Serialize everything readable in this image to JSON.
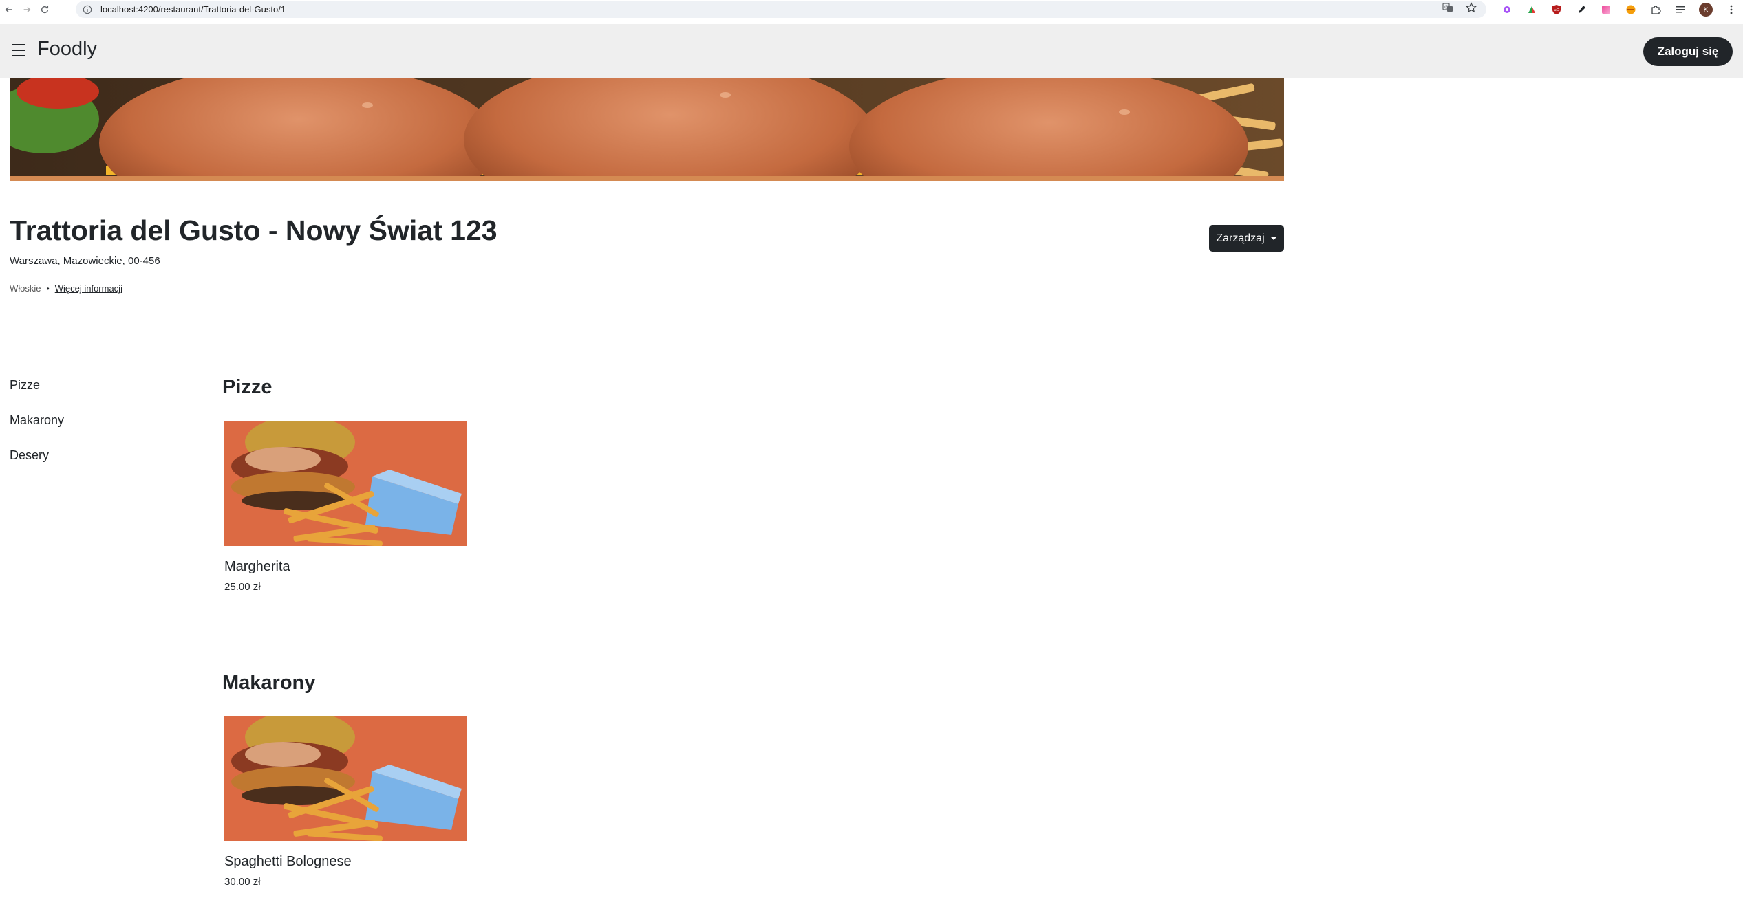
{
  "browser": {
    "url": "localhost:4200/restaurant/Trattoria-del-Gusto/1",
    "profile_initial": "K",
    "icons": [
      "back-arrow-icon",
      "forward-arrow-icon",
      "reload-icon",
      "site-info-icon",
      "translate-icon",
      "bookmark-star-icon",
      "extension-icons",
      "puzzle-extensions-icon",
      "reading-list-icon",
      "kebab-menu-icon"
    ]
  },
  "navbar": {
    "brand": "Foodly",
    "login_label": "Zaloguj się"
  },
  "restaurant": {
    "title": "Trattoria del Gusto - Nowy Świat 123",
    "address": "Warszawa, Mazowieckie, 00-456",
    "cuisine": "Włoskie",
    "separator": "•",
    "more_info": "Więcej informacji",
    "manage_label": "Zarządzaj"
  },
  "categories": [
    {
      "label": "Pizze"
    },
    {
      "label": "Makarony"
    },
    {
      "label": "Desery"
    }
  ],
  "sections": [
    {
      "title": "Pizze",
      "dishes": [
        {
          "name": "Margherita",
          "price": "25.00 zł"
        }
      ]
    },
    {
      "title": "Makarony",
      "dishes": [
        {
          "name": "Spaghetti Bolognese",
          "price": "30.00 zł"
        }
      ]
    }
  ],
  "colors": {
    "navbar_bg": "#efefef",
    "dark": "#212529",
    "dish_image_bg": "#dc6a43",
    "fries_box": "#7ab3e8"
  }
}
